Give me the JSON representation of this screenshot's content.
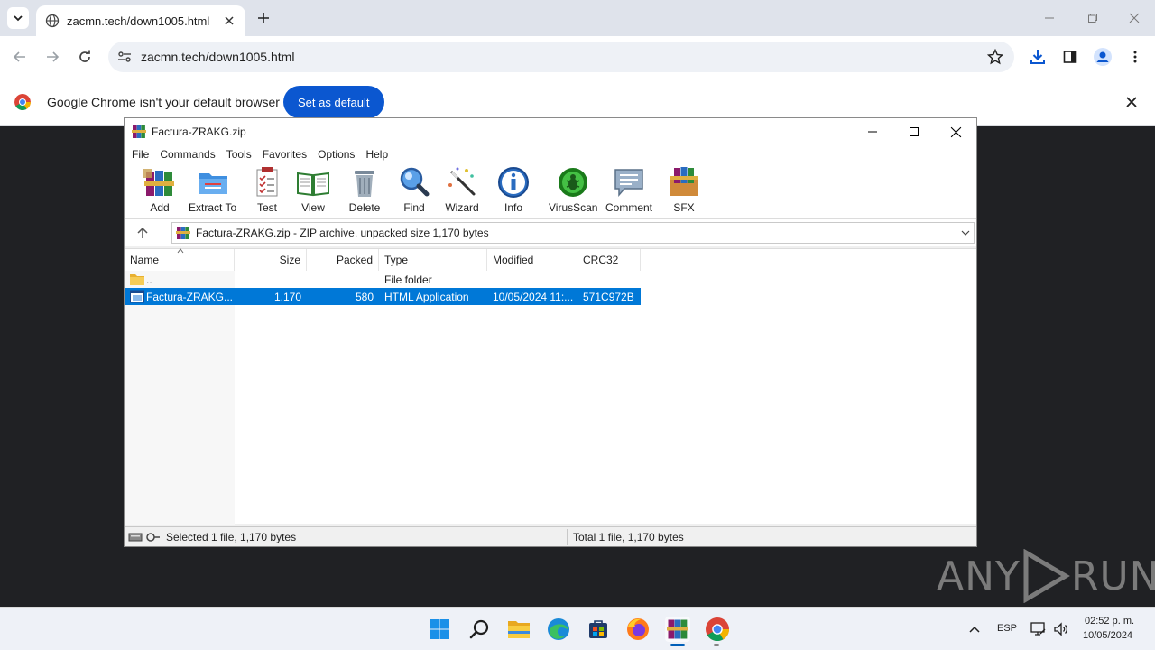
{
  "browser": {
    "tab": {
      "title": "zacmn.tech/down1005.html"
    },
    "address_bar": {
      "url": "zacmn.tech/down1005.html"
    },
    "infobar": {
      "message": "Google Chrome isn't your default browser",
      "button_label": "Set as default"
    }
  },
  "winrar": {
    "title": "Factura-ZRAKG.zip",
    "menu": [
      "File",
      "Commands",
      "Tools",
      "Favorites",
      "Options",
      "Help"
    ],
    "toolbar": [
      "Add",
      "Extract To",
      "Test",
      "View",
      "Delete",
      "Find",
      "Wizard",
      "Info",
      "VirusScan",
      "Comment",
      "SFX"
    ],
    "path": "Factura-ZRAKG.zip - ZIP archive, unpacked size 1,170 bytes",
    "columns": [
      "Name",
      "Size",
      "Packed",
      "Type",
      "Modified",
      "CRC32"
    ],
    "rows": [
      {
        "name": "..",
        "size": "",
        "packed": "",
        "type": "File folder",
        "modified": "",
        "crc": ""
      },
      {
        "name": "Factura-ZRAKG....",
        "size": "1,170",
        "packed": "580",
        "type": "HTML Application",
        "modified": "10/05/2024 11:...",
        "crc": "571C972B"
      }
    ],
    "status_left": "Selected 1 file, 1,170 bytes",
    "status_right": "Total 1 file, 1,170 bytes"
  },
  "watermark": {
    "left": "ANY",
    "right": "RUN"
  },
  "taskbar": {
    "language": "ESP",
    "time": "02:52 p. m.",
    "date": "10/05/2024"
  },
  "colors": {
    "accent": "#0b57d0",
    "selection": "#0078d7"
  }
}
